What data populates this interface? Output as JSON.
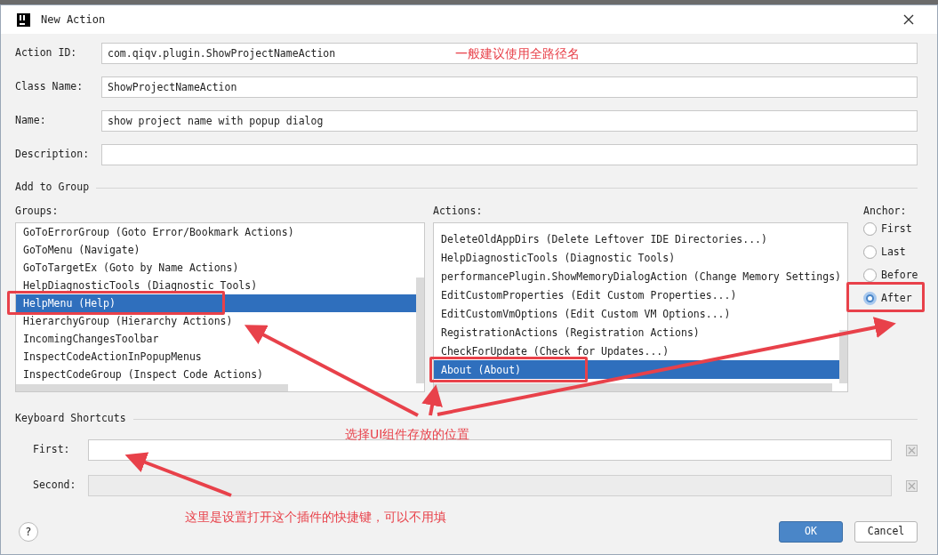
{
  "window": {
    "title": "New Action"
  },
  "fields": [
    {
      "label": "Action ID:",
      "value": "com.qiqv.plugin.ShowProjectNameAction"
    },
    {
      "label": "Class Name:",
      "value": "ShowProjectNameAction"
    },
    {
      "label": "Name:",
      "value": "show project name with popup dialog"
    },
    {
      "label": "Description:"
    }
  ],
  "add_to_group": {
    "title": "Add to Group",
    "groups": {
      "label": "Groups:",
      "items": [
        {
          "text": "GoToErrorGroup (Goto Error/Bookmark Actions)",
          "selected": false
        },
        {
          "text": "GoToMenu (Navigate)",
          "selected": false
        },
        {
          "text": "GoToTargetEx (Goto by Name Actions)",
          "selected": false
        },
        {
          "text": "HelpDiagnosticTools (Diagnostic Tools)",
          "selected": false
        },
        {
          "text": "HelpMenu (Help)",
          "selected": true
        },
        {
          "text": "HierarchyGroup (Hierarchy Actions)",
          "selected": false
        },
        {
          "text": "IncomingChangesToolbar",
          "selected": false
        },
        {
          "text": "InspectCodeActionInPopupMenus",
          "selected": false
        },
        {
          "text": "InspectCodeGroup (Inspect Code Actions)",
          "selected": false
        }
      ]
    },
    "actions": {
      "label": "Actions:",
      "items": [
        {
          "text": "DeleteOldAppDirs (Delete Leftover IDE Directories...)",
          "selected": false
        },
        {
          "text": "HelpDiagnosticTools (Diagnostic Tools)",
          "selected": false
        },
        {
          "text": "performancePlugin.ShowMemoryDialogAction (Change Memory Settings)",
          "selected": false
        },
        {
          "text": "EditCustomProperties (Edit Custom Properties...)",
          "selected": false
        },
        {
          "text": "EditCustomVmOptions (Edit Custom VM Options...)",
          "selected": false
        },
        {
          "text": "RegistrationActions (Registration Actions)",
          "selected": false
        },
        {
          "text": "CheckForUpdate (Check for Updates...)",
          "selected": false
        },
        {
          "text": "About (About)",
          "selected": true
        }
      ]
    },
    "anchor": {
      "label": "Anchor:",
      "options": [
        {
          "label": "First",
          "selected": false
        },
        {
          "label": "Last",
          "selected": false
        },
        {
          "label": "Before",
          "selected": false
        },
        {
          "label": "After",
          "selected": true
        }
      ]
    }
  },
  "keyboard_shortcuts": {
    "title": "Keyboard Shortcuts",
    "fields": [
      {
        "label": "First:",
        "disabled": false
      },
      {
        "label": "Second:",
        "disabled": true
      }
    ]
  },
  "buttons": {
    "help": "?",
    "ok": "OK",
    "cancel": "Cancel"
  },
  "annotations": [
    "一般建议使用全路径名",
    "选择UI组件存放的位置",
    "这里是设置打开这个插件的快捷键，可以不用填"
  ]
}
